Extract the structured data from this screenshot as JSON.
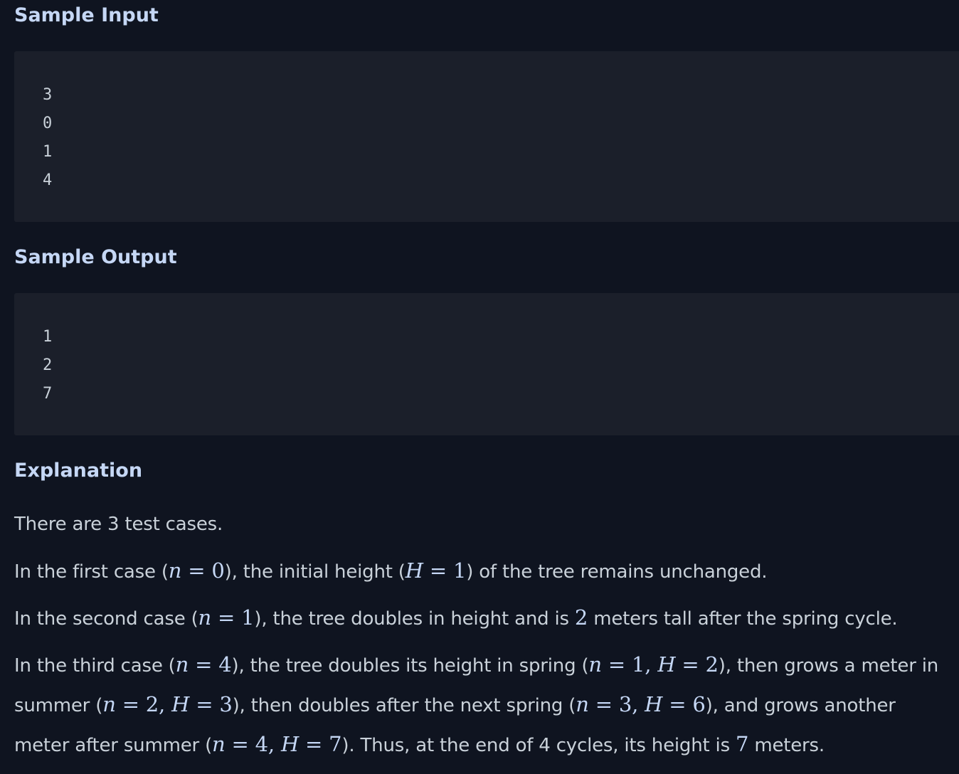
{
  "sample_input": {
    "heading": "Sample Input",
    "lines": [
      "3",
      "0",
      "1",
      "4"
    ]
  },
  "sample_output": {
    "heading": "Sample Output",
    "lines": [
      "1",
      "2",
      "7"
    ]
  },
  "explanation": {
    "heading": "Explanation",
    "p1": "There are 3 test cases.",
    "p2": {
      "a": "In the first case (",
      "n": "n",
      "eq1": " = 0",
      "b": "), the initial height (",
      "H": "H",
      "eq2": " = 1",
      "c": ") of the tree remains unchanged."
    },
    "p3": {
      "a": "In the second case (",
      "n": "n",
      "eq1": " = 1",
      "b": "), the tree doubles in height and is ",
      "v": "2",
      "c": " meters tall after the spring cycle."
    },
    "p4": {
      "a": "In the third case (",
      "n1": "n",
      "eq1": " = 4",
      "b": "), the tree doubles its height in spring (",
      "n2": "n",
      "eq2": " = 1, ",
      "H1": "H",
      "eq3": " = 2",
      "c": "), then grows a meter in"
    },
    "p5": {
      "a": "summer (",
      "n1": "n",
      "eq1": " = 2, ",
      "H1": "H",
      "eq2": " = 3",
      "b": "), then doubles after the next spring (",
      "n2": "n",
      "eq3": " = 3, ",
      "H2": "H",
      "eq4": " = 6",
      "c": "), and grows another"
    },
    "p6": {
      "a": "meter after summer (",
      "n1": "n",
      "eq1": " = 4, ",
      "H1": "H",
      "eq2": " = 7",
      "b": "). Thus, at the end of 4 cycles, its height is ",
      "v": "7",
      "c": " meters."
    }
  }
}
